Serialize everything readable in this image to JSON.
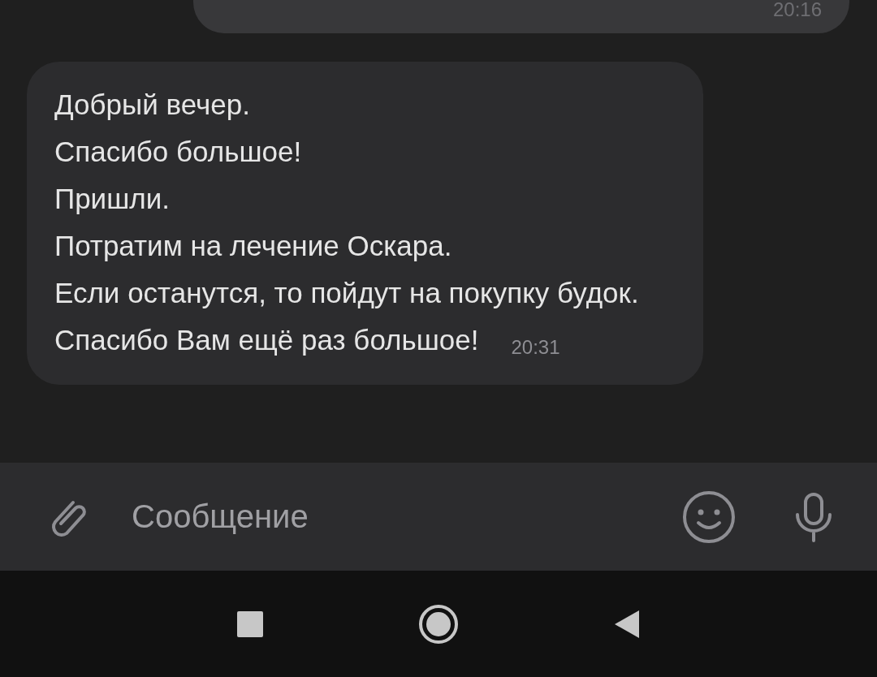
{
  "previous_message": {
    "time": "20:16"
  },
  "message": {
    "lines": [
      "Добрый вечер.",
      "Спасибо большое!",
      "Пришли.",
      "Потратим на лечение Оскара.",
      "Если останутся, то пойдут на покупку будок.",
      "Спасибо Вам ещё раз большое!"
    ],
    "time": "20:31"
  },
  "composer": {
    "placeholder": "Сообщение"
  }
}
